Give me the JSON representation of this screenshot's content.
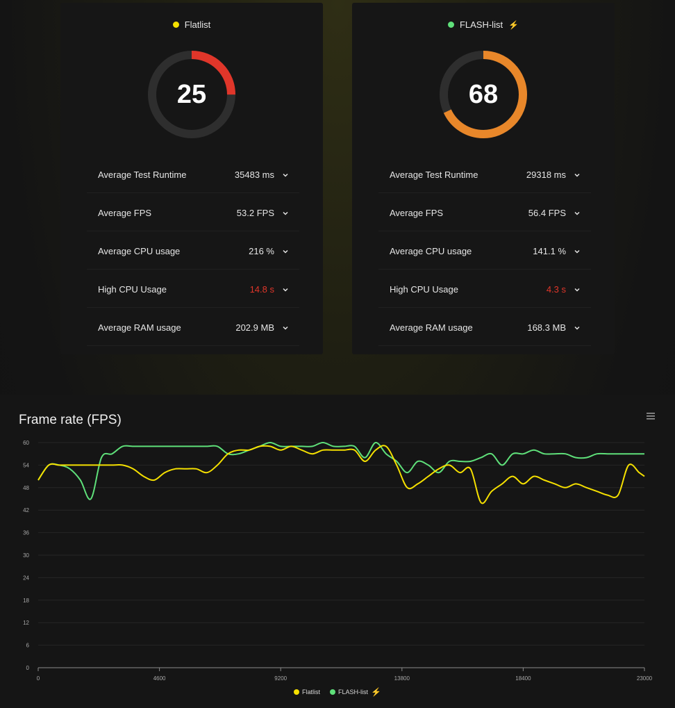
{
  "cards": [
    {
      "name": "Flatlist",
      "dot_color": "#f5e000",
      "bolt": "",
      "score": "25",
      "score_value": 25,
      "gauge_color": "#e0362a",
      "metrics": [
        {
          "label": "Average Test Runtime",
          "value": "35483 ms"
        },
        {
          "label": "Average FPS",
          "value": "53.2 FPS"
        },
        {
          "label": "Average CPU usage",
          "value": "216 %"
        },
        {
          "label": "High CPU Usage",
          "value": "14.8 s",
          "highlight": true
        },
        {
          "label": "Average RAM usage",
          "value": "202.9 MB"
        }
      ]
    },
    {
      "name": "FLASH-list",
      "dot_color": "#5fe07a",
      "bolt": "⚡",
      "score": "68",
      "score_value": 68,
      "gauge_color": "#e8872a",
      "metrics": [
        {
          "label": "Average Test Runtime",
          "value": "29318 ms"
        },
        {
          "label": "Average FPS",
          "value": "56.4 FPS"
        },
        {
          "label": "Average CPU usage",
          "value": "141.1 %"
        },
        {
          "label": "High CPU Usage",
          "value": "4.3 s",
          "highlight": true
        },
        {
          "label": "Average RAM usage",
          "value": "168.3 MB"
        }
      ]
    }
  ],
  "menu_icon": "hamburger-menu-icon",
  "chart_data": {
    "type": "line",
    "title": "Frame rate (FPS)",
    "xlim": [
      0,
      23000
    ],
    "ylim": [
      0,
      60
    ],
    "x_ticks": [
      "0",
      "4600",
      "9200",
      "13800",
      "18400",
      "23000"
    ],
    "y_ticks": [
      "0",
      "6",
      "12",
      "18",
      "24",
      "30",
      "36",
      "42",
      "48",
      "54",
      "60"
    ],
    "grid": true,
    "legend_position": "bottom-center",
    "series": [
      {
        "name": "Flatlist",
        "color": "#f5e000",
        "x": [
          0,
          400,
          800,
          1200,
          1600,
          2000,
          2400,
          2800,
          3200,
          3600,
          4000,
          4400,
          4800,
          5200,
          5600,
          6000,
          6400,
          6800,
          7200,
          7600,
          8000,
          8400,
          8800,
          9200,
          9600,
          10000,
          10400,
          10800,
          11200,
          11600,
          12000,
          12400,
          12800,
          13200,
          13600,
          14000,
          14400,
          14800,
          15200,
          15600,
          16000,
          16400,
          16800,
          17200,
          17600,
          18000,
          18400,
          18800,
          19200,
          19600,
          20000,
          20400,
          20800,
          21200,
          21600,
          22000,
          22400,
          22800,
          23000
        ],
        "values": [
          50,
          54,
          54,
          54,
          54,
          54,
          54,
          54,
          54,
          53,
          51,
          50,
          52,
          53,
          53,
          53,
          52,
          54,
          57,
          58,
          58,
          59,
          59,
          58,
          59,
          58,
          57,
          58,
          58,
          58,
          58,
          55,
          58,
          59,
          54,
          48,
          49,
          51,
          53,
          54,
          52,
          53,
          44,
          47,
          49,
          51,
          49,
          51,
          50,
          49,
          48,
          49,
          48,
          47,
          46,
          46,
          54,
          52,
          51
        ]
      },
      {
        "name": "FLASH-list",
        "color": "#5fe07a",
        "x": [
          0,
          400,
          800,
          1200,
          1600,
          2000,
          2400,
          2800,
          3200,
          3600,
          4000,
          4400,
          4800,
          5200,
          5600,
          6000,
          6400,
          6800,
          7200,
          7600,
          8000,
          8400,
          8800,
          9200,
          9600,
          10000,
          10400,
          10800,
          11200,
          11600,
          12000,
          12400,
          12800,
          13200,
          13600,
          14000,
          14400,
          14800,
          15200,
          15600,
          16000,
          16400,
          16800,
          17200,
          17600,
          18000,
          18400,
          18800,
          19200,
          19600,
          20000,
          20400,
          20800,
          21200,
          21600,
          22000,
          22400,
          22800,
          23000
        ],
        "values": [
          50,
          54,
          54,
          53,
          50,
          45,
          56,
          57,
          59,
          59,
          59,
          59,
          59,
          59,
          59,
          59,
          59,
          59,
          57,
          57,
          58,
          59,
          60,
          59,
          59,
          59,
          59,
          60,
          59,
          59,
          59,
          56,
          60,
          57,
          55,
          52,
          55,
          54,
          52,
          55,
          55,
          55,
          56,
          57,
          54,
          57,
          57,
          58,
          57,
          57,
          57,
          56,
          56,
          57,
          57,
          57,
          57,
          57,
          57
        ]
      }
    ]
  }
}
